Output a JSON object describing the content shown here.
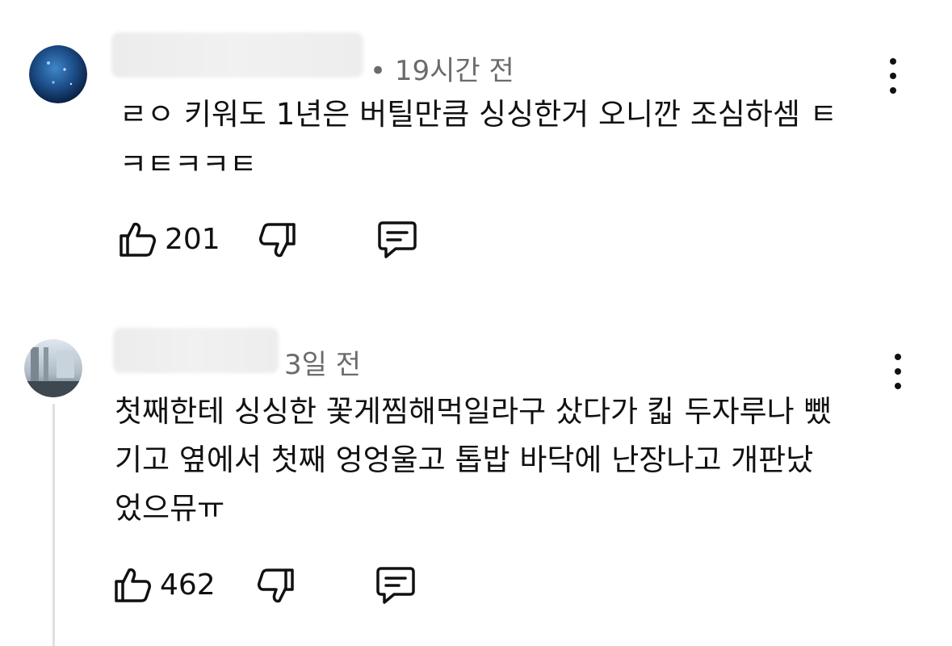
{
  "comments": [
    {
      "time": "• 19시간 전",
      "lines": [
        "ㄹㅇ 키워도 1년은 버틸만큼 싱싱한거 오니깐 조심하셈 ㅌ",
        "ㅋㅌㅋㅋㅌ"
      ],
      "likes": "201",
      "icons": [
        "avatar",
        "like-icon",
        "dislike-icon",
        "reply-icon",
        "more-options-icon"
      ]
    },
    {
      "time": "3일 전",
      "lines": [
        "첫째한테 싱싱한 꽃게찜해먹일라구 샀다가 킯 두자루나 뺐",
        "기고 옆에서 첫째 엉엉울고 톱밥 바닥에 난장나고 개판났",
        "었으뮤ㅠ"
      ],
      "likes": "462",
      "icons": [
        "avatar",
        "like-icon",
        "dislike-icon",
        "reply-icon",
        "more-options-icon"
      ]
    }
  ]
}
